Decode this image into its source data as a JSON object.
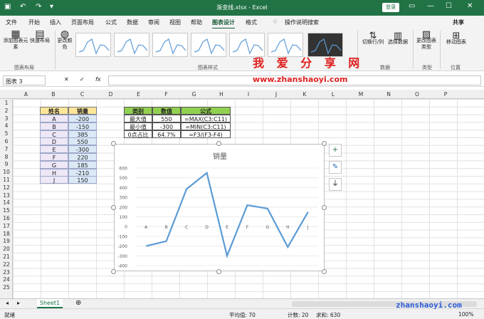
{
  "title": "渐变线.xlsx - Excel",
  "login": "登录",
  "menu": [
    "文件",
    "开始",
    "插入",
    "页面布局",
    "公式",
    "数据",
    "审阅",
    "视图",
    "帮助",
    "图表设计",
    "格式"
  ],
  "search": "操作说明搜索",
  "share": "共享",
  "ribbon": {
    "add_elem": "添加图表元素",
    "quick_layout": "快速布局",
    "change_color": "更改颜色",
    "switch": "切换行/列",
    "select_data": "选择数据",
    "change_type": "更改图表类型",
    "move": "移动图表",
    "grp_layout": "图表布局",
    "grp_style": "图表样式",
    "grp_data": "数据",
    "grp_type": "类型",
    "grp_pos": "位置"
  },
  "namebox": "图表 3",
  "fx": "fx",
  "columns": [
    "A",
    "B",
    "C",
    "D",
    "E",
    "F",
    "G",
    "H",
    "I",
    "J",
    "K",
    "L",
    "M",
    "N",
    "O",
    "P"
  ],
  "rows": [
    "1",
    "2",
    "3",
    "4",
    "5",
    "6",
    "7",
    "8",
    "9",
    "10",
    "11",
    "12",
    "13",
    "14",
    "15",
    "16",
    "17",
    "18",
    "19",
    "20",
    "21",
    "22",
    "23",
    "24",
    "25"
  ],
  "table1": {
    "headers": [
      "姓名",
      "销量"
    ],
    "rows": [
      [
        "A",
        "-200"
      ],
      [
        "B",
        "-150"
      ],
      [
        "C",
        "385"
      ],
      [
        "D",
        "550"
      ],
      [
        "E",
        "-300"
      ],
      [
        "F",
        "220"
      ],
      [
        "G",
        "185"
      ],
      [
        "H",
        "-210"
      ],
      [
        "J",
        "150"
      ]
    ]
  },
  "table2": {
    "headers": [
      "类别",
      "数值",
      "公式"
    ],
    "rows": [
      [
        "最大值",
        "550",
        "=MAX(C3:C11)"
      ],
      [
        "最小值",
        "-300",
        "=MIN(C3:C11)"
      ],
      [
        "0点占比",
        "64.7%",
        "=F3/(F3-F4)"
      ]
    ]
  },
  "chart_data": {
    "type": "line",
    "title": "销量",
    "categories": [
      "A",
      "B",
      "C",
      "D",
      "E",
      "F",
      "G",
      "H",
      "J"
    ],
    "series": [
      {
        "values": [
          -200,
          -150,
          385,
          550,
          -300,
          220,
          185,
          -210,
          150
        ]
      }
    ],
    "ylim": [
      -400,
      600
    ],
    "yticks": [
      "600",
      "500",
      "400",
      "300",
      "200",
      "100",
      "0",
      "-100",
      "-200",
      "-300",
      "-400"
    ],
    "grid": true,
    "color": "#5b9bd5"
  },
  "watermark": {
    "line1": "我 爱 分 享 网",
    "line2": "www.zhanshaoyi.com",
    "line3": "zhanshaoyi.com"
  },
  "sheet": "Sheet1",
  "status": {
    "ready": "就绪",
    "avg": "平均值: 70",
    "count": "计数: 20",
    "sum": "求和: 630",
    "zoom": "100%"
  }
}
